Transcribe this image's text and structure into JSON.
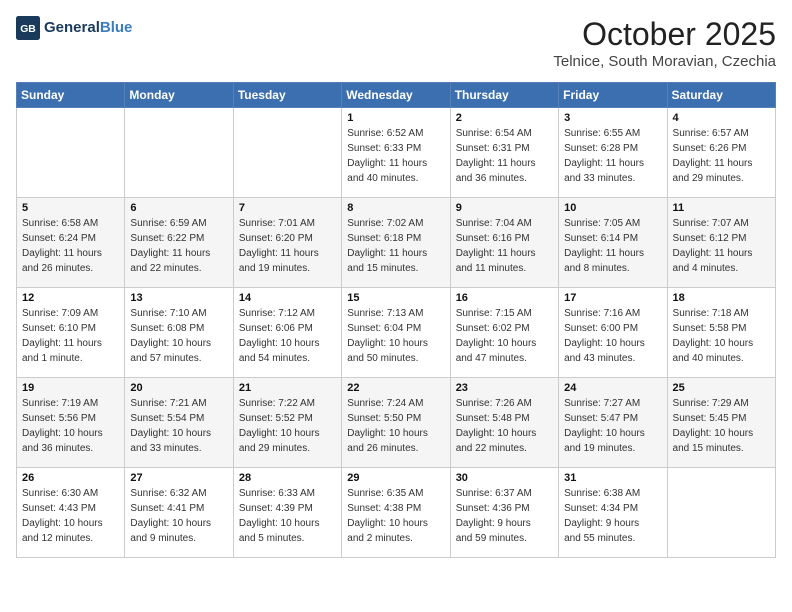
{
  "header": {
    "logo_line1": "General",
    "logo_line2": "Blue",
    "month": "October 2025",
    "location": "Telnice, South Moravian, Czechia"
  },
  "weekdays": [
    "Sunday",
    "Monday",
    "Tuesday",
    "Wednesday",
    "Thursday",
    "Friday",
    "Saturday"
  ],
  "weeks": [
    [
      {
        "day": "",
        "info": ""
      },
      {
        "day": "",
        "info": ""
      },
      {
        "day": "",
        "info": ""
      },
      {
        "day": "1",
        "info": "Sunrise: 6:52 AM\nSunset: 6:33 PM\nDaylight: 11 hours\nand 40 minutes."
      },
      {
        "day": "2",
        "info": "Sunrise: 6:54 AM\nSunset: 6:31 PM\nDaylight: 11 hours\nand 36 minutes."
      },
      {
        "day": "3",
        "info": "Sunrise: 6:55 AM\nSunset: 6:28 PM\nDaylight: 11 hours\nand 33 minutes."
      },
      {
        "day": "4",
        "info": "Sunrise: 6:57 AM\nSunset: 6:26 PM\nDaylight: 11 hours\nand 29 minutes."
      }
    ],
    [
      {
        "day": "5",
        "info": "Sunrise: 6:58 AM\nSunset: 6:24 PM\nDaylight: 11 hours\nand 26 minutes."
      },
      {
        "day": "6",
        "info": "Sunrise: 6:59 AM\nSunset: 6:22 PM\nDaylight: 11 hours\nand 22 minutes."
      },
      {
        "day": "7",
        "info": "Sunrise: 7:01 AM\nSunset: 6:20 PM\nDaylight: 11 hours\nand 19 minutes."
      },
      {
        "day": "8",
        "info": "Sunrise: 7:02 AM\nSunset: 6:18 PM\nDaylight: 11 hours\nand 15 minutes."
      },
      {
        "day": "9",
        "info": "Sunrise: 7:04 AM\nSunset: 6:16 PM\nDaylight: 11 hours\nand 11 minutes."
      },
      {
        "day": "10",
        "info": "Sunrise: 7:05 AM\nSunset: 6:14 PM\nDaylight: 11 hours\nand 8 minutes."
      },
      {
        "day": "11",
        "info": "Sunrise: 7:07 AM\nSunset: 6:12 PM\nDaylight: 11 hours\nand 4 minutes."
      }
    ],
    [
      {
        "day": "12",
        "info": "Sunrise: 7:09 AM\nSunset: 6:10 PM\nDaylight: 11 hours\nand 1 minute."
      },
      {
        "day": "13",
        "info": "Sunrise: 7:10 AM\nSunset: 6:08 PM\nDaylight: 10 hours\nand 57 minutes."
      },
      {
        "day": "14",
        "info": "Sunrise: 7:12 AM\nSunset: 6:06 PM\nDaylight: 10 hours\nand 54 minutes."
      },
      {
        "day": "15",
        "info": "Sunrise: 7:13 AM\nSunset: 6:04 PM\nDaylight: 10 hours\nand 50 minutes."
      },
      {
        "day": "16",
        "info": "Sunrise: 7:15 AM\nSunset: 6:02 PM\nDaylight: 10 hours\nand 47 minutes."
      },
      {
        "day": "17",
        "info": "Sunrise: 7:16 AM\nSunset: 6:00 PM\nDaylight: 10 hours\nand 43 minutes."
      },
      {
        "day": "18",
        "info": "Sunrise: 7:18 AM\nSunset: 5:58 PM\nDaylight: 10 hours\nand 40 minutes."
      }
    ],
    [
      {
        "day": "19",
        "info": "Sunrise: 7:19 AM\nSunset: 5:56 PM\nDaylight: 10 hours\nand 36 minutes."
      },
      {
        "day": "20",
        "info": "Sunrise: 7:21 AM\nSunset: 5:54 PM\nDaylight: 10 hours\nand 33 minutes."
      },
      {
        "day": "21",
        "info": "Sunrise: 7:22 AM\nSunset: 5:52 PM\nDaylight: 10 hours\nand 29 minutes."
      },
      {
        "day": "22",
        "info": "Sunrise: 7:24 AM\nSunset: 5:50 PM\nDaylight: 10 hours\nand 26 minutes."
      },
      {
        "day": "23",
        "info": "Sunrise: 7:26 AM\nSunset: 5:48 PM\nDaylight: 10 hours\nand 22 minutes."
      },
      {
        "day": "24",
        "info": "Sunrise: 7:27 AM\nSunset: 5:47 PM\nDaylight: 10 hours\nand 19 minutes."
      },
      {
        "day": "25",
        "info": "Sunrise: 7:29 AM\nSunset: 5:45 PM\nDaylight: 10 hours\nand 15 minutes."
      }
    ],
    [
      {
        "day": "26",
        "info": "Sunrise: 6:30 AM\nSunset: 4:43 PM\nDaylight: 10 hours\nand 12 minutes."
      },
      {
        "day": "27",
        "info": "Sunrise: 6:32 AM\nSunset: 4:41 PM\nDaylight: 10 hours\nand 9 minutes."
      },
      {
        "day": "28",
        "info": "Sunrise: 6:33 AM\nSunset: 4:39 PM\nDaylight: 10 hours\nand 5 minutes."
      },
      {
        "day": "29",
        "info": "Sunrise: 6:35 AM\nSunset: 4:38 PM\nDaylight: 10 hours\nand 2 minutes."
      },
      {
        "day": "30",
        "info": "Sunrise: 6:37 AM\nSunset: 4:36 PM\nDaylight: 9 hours\nand 59 minutes."
      },
      {
        "day": "31",
        "info": "Sunrise: 6:38 AM\nSunset: 4:34 PM\nDaylight: 9 hours\nand 55 minutes."
      },
      {
        "day": "",
        "info": ""
      }
    ]
  ]
}
